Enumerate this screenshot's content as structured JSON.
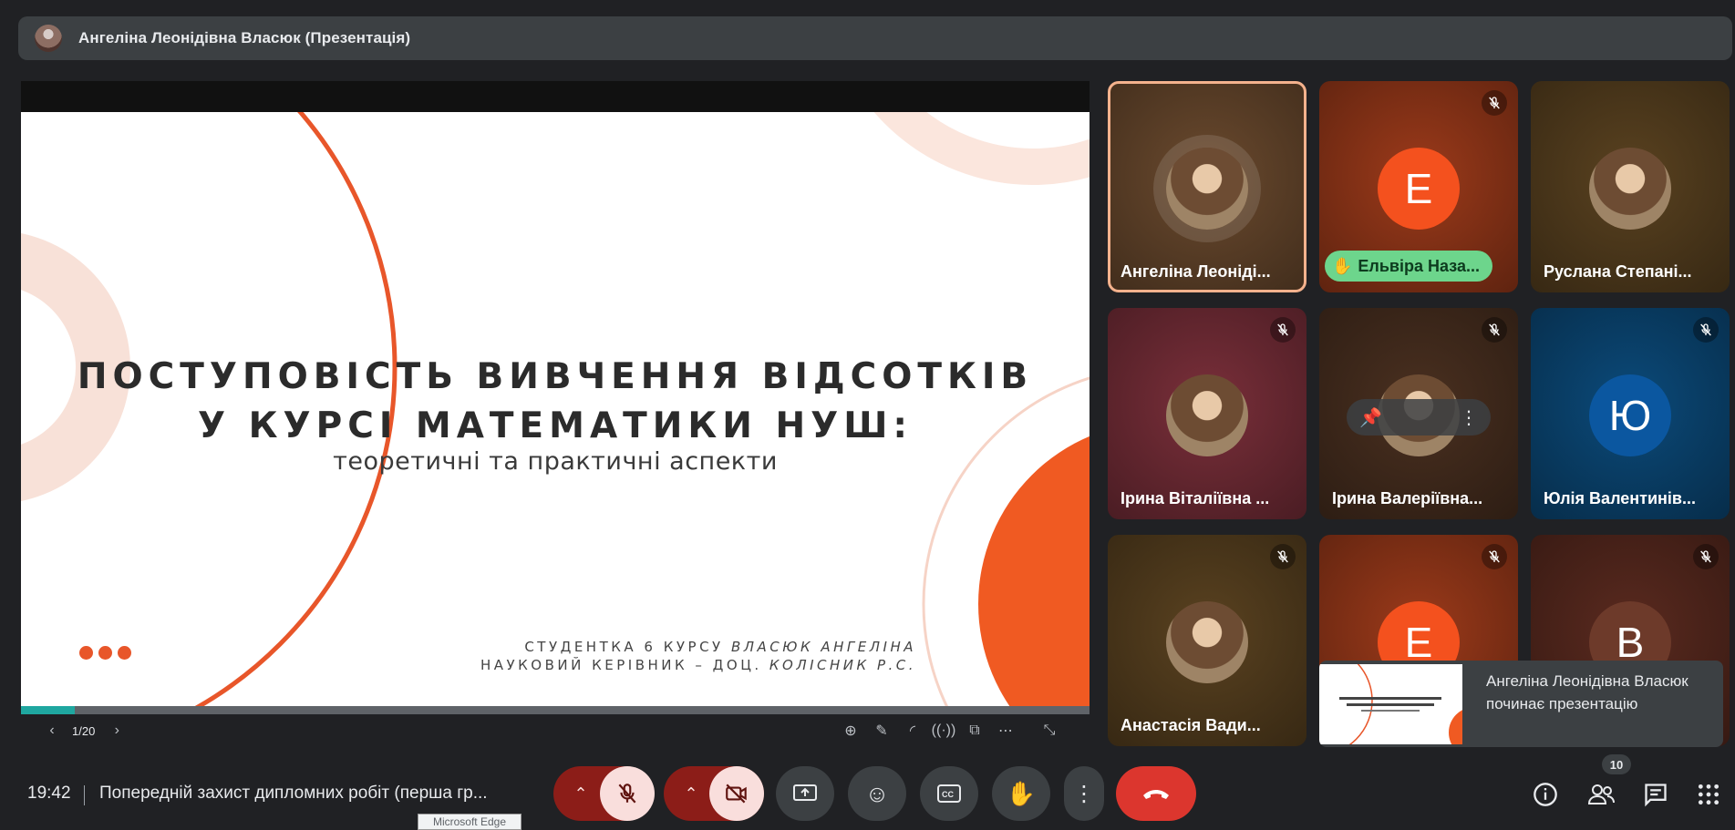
{
  "topbar": {
    "title": "Ангеліна Леонідівна Власюк (Презентація)"
  },
  "slide": {
    "title_line1": "ПОСТУПОВІСТЬ ВИВЧЕННЯ ВІДСОТКІВ",
    "title_line2": "У КУРСІ МАТЕМАТИКИ НУШ:",
    "subtitle": "теоретичні та практичні аспекти",
    "student_prefix": "СТУДЕНТКА 6 КУРСУ ",
    "student_name": "ВЛАСЮК АНГЕЛІНА",
    "advisor_prefix": "НАУКОВИЙ КЕРІВНИК – ДОЦ. ",
    "advisor_name": "КОЛІСНИК Р.С.",
    "page": "1/20",
    "progress": 0.05,
    "accent": "#e8562a"
  },
  "tiles": [
    {
      "name": "Ангеліна Леоніді...",
      "type": "photo",
      "bg": "#6b4a2e",
      "active": true,
      "muted": false
    },
    {
      "name": "Ельвіра Наза...",
      "type": "letter",
      "letter": "Е",
      "bg": "#9c3a1a",
      "circle": "#f4511e",
      "muted": true,
      "hand_raised": true
    },
    {
      "name": "Руслана Степані...",
      "type": "photo",
      "bg": "#5a4220",
      "muted": false
    },
    {
      "name": "Ірина Віталіївна ...",
      "type": "photo",
      "bg": "#7a2f3a",
      "muted": true
    },
    {
      "name": "Ірина Валеріївна...",
      "type": "photo",
      "bg": "#4a3020",
      "muted": true
    },
    {
      "name": "Юлія Валентинів...",
      "type": "letter",
      "letter": "Ю",
      "bg": "#0b4a7a",
      "circle": "#0b57a0",
      "muted": true
    },
    {
      "name": "Анастасія Вади...",
      "type": "photo",
      "bg": "#5a4220",
      "muted": true
    },
    {
      "name": "",
      "type": "letter",
      "letter": "Е",
      "bg": "#9c3a1a",
      "circle": "#f4511e",
      "muted": true
    },
    {
      "name": "",
      "type": "letter",
      "letter": "В",
      "bg": "#5a2a1f",
      "circle": "#6d3a2a",
      "muted": true
    }
  ],
  "toast": {
    "message": "Ангеліна Леонідівна Власюк починає презентацію"
  },
  "bottombar": {
    "time": "19:42",
    "meeting": "Попередній захист дипломних робіт (перша гр...",
    "tooltip": "Microsoft Edge",
    "participants_count": "10"
  },
  "icons": {
    "mic": "mic-off-icon",
    "camera": "camera-off-icon",
    "present": "present-icon",
    "emoji": "emoji-icon",
    "captions": "captions-icon",
    "hand": "raise-hand-icon",
    "more": "more-vert-icon",
    "end": "end-call-icon",
    "info": "info-icon",
    "people": "people-icon",
    "chat": "chat-icon",
    "activities": "apps-icon"
  }
}
